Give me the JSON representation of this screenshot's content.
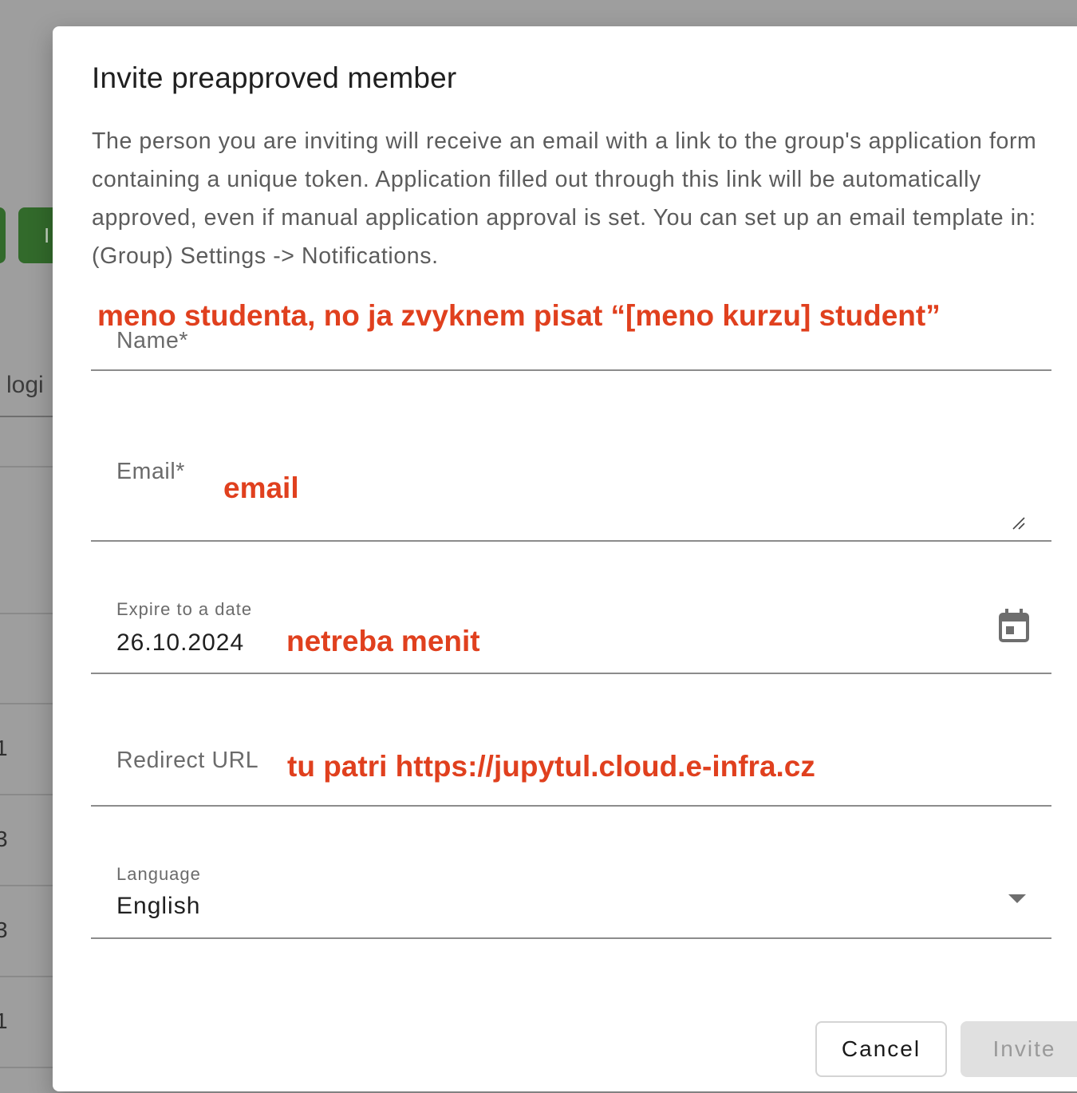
{
  "background": {
    "button_letter": "I",
    "column_header": "logi",
    "row_digits": [
      "1",
      "3",
      "3",
      "1"
    ]
  },
  "dialog": {
    "title": "Invite preapproved member",
    "description": "The person you are inviting will receive an email with a link to the group's application form containing a unique token. Application filled out through this link will be automatically approved, even if manual application approval is set. You can set up an email template in: (Group) Settings -> Notifications.",
    "fields": {
      "name": {
        "label": "Name*",
        "value": ""
      },
      "email": {
        "label": "Email*",
        "value": ""
      },
      "expire": {
        "label": "Expire to a date",
        "value": "26.10.2024",
        "icon": "calendar-icon"
      },
      "redirect_url": {
        "label": "Redirect URL",
        "value": ""
      },
      "language": {
        "label": "Language",
        "value": "English",
        "icon": "dropdown-arrow-icon"
      }
    },
    "buttons": {
      "cancel": "Cancel",
      "invite": "Invite"
    }
  },
  "annotations": {
    "name_note": "meno studenta, no ja zvyknem pisat “[meno kurzu] student”",
    "email_note": "email",
    "expire_note": "netreba menit",
    "redirect_note": "tu patri https://jupytul.cloud.e-infra.cz"
  },
  "colors": {
    "annotation": "#e0401e",
    "background_button": "#326a2b",
    "disabled_button": "#e0e0e0"
  }
}
